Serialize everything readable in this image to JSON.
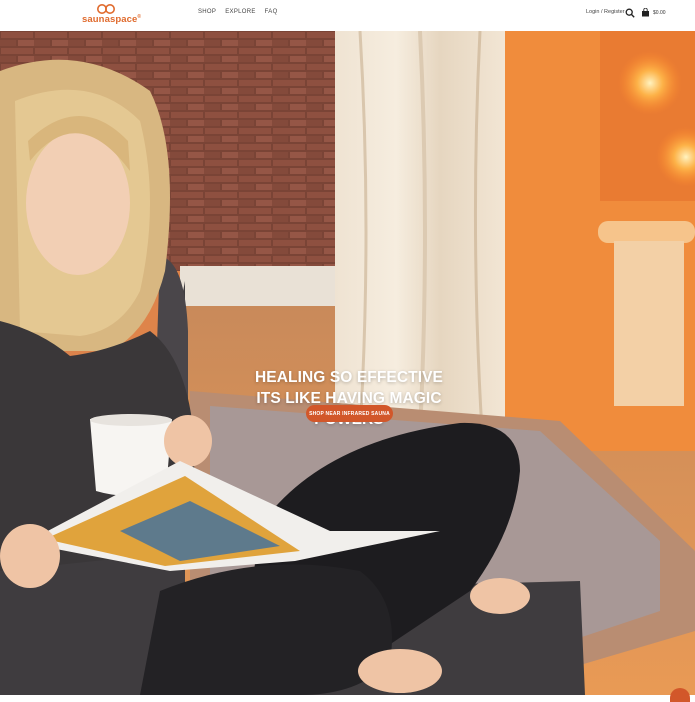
{
  "header": {
    "logo_text": "saunaspace",
    "nav": [
      "SHOP",
      "EXPLORE",
      "FAQ"
    ],
    "account_label": "Login / Register",
    "cart_amount": "$0.00"
  },
  "hero": {
    "headline_line1": "HEALING SO EFFECTIVE",
    "headline_line2": "ITS LIKE HAVING MAGIC",
    "headline_line3": "POWERS",
    "cta_label": "SHOP NEAR INFRARED SAUNA"
  },
  "colors": {
    "brand_orange": "#e06b2e",
    "cta": "#d2572a"
  }
}
